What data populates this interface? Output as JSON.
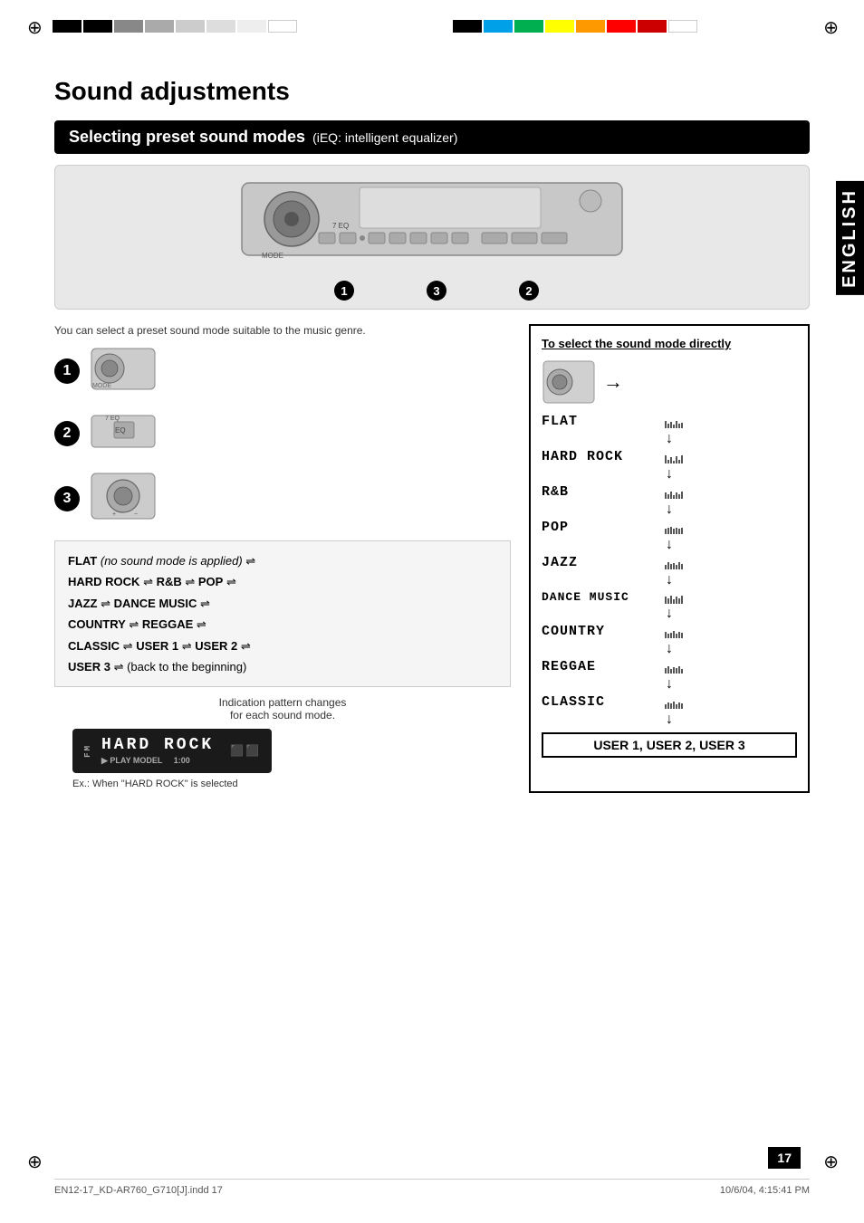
{
  "page": {
    "title": "Sound adjustments",
    "number": "17"
  },
  "section": {
    "header": "Selecting preset sound modes",
    "header_sub": "(iEQ: intelligent equalizer)"
  },
  "english_label": "ENGLISH",
  "device_numbers": [
    "1",
    "3",
    "2"
  ],
  "body_text": "You can select a preset sound mode suitable to the music genre.",
  "steps": [
    {
      "num": "1",
      "label": "MODE button"
    },
    {
      "num": "2",
      "label": "EQ button"
    },
    {
      "num": "3",
      "label": "Volume knob"
    }
  ],
  "mode_cycle": {
    "line1_bold": "FLAT",
    "line1_italic": " (no sound mode is applied)",
    "line1_sym": " ⇌",
    "line2": "HARD ROCK ⇌ R&B ⇌ POP ⇌",
    "line3": "JAZZ ⇌ DANCE MUSIC ⇌",
    "line4": "COUNTRY ⇌ REGGAE ⇌",
    "line5": "CLASSIC ⇌ USER 1 ⇌ USER 2 ⇌",
    "line6_bold": "USER 3",
    "line6": " ⇌ (back to the beginning)"
  },
  "indication_text": "Indication pattern changes\nfor each sound mode.",
  "example_label": "Ex.: When \"HARD ROCK\" is selected",
  "example_display": "HARD ROCK",
  "right_col": {
    "title": "To select the sound mode directly",
    "modes": [
      {
        "name": "FLAT",
        "bars": [
          8,
          5,
          7,
          4,
          8,
          3,
          6
        ]
      },
      {
        "name": "HARD ROCK",
        "bars": [
          9,
          4,
          7,
          3,
          8,
          4,
          9
        ]
      },
      {
        "name": "R&B",
        "bars": [
          7,
          5,
          8,
          4,
          7,
          5,
          8
        ]
      },
      {
        "name": "POP",
        "bars": [
          6,
          7,
          8,
          6,
          7,
          6,
          7
        ]
      },
      {
        "name": "JAZZ",
        "bars": [
          5,
          8,
          6,
          7,
          5,
          8,
          6
        ]
      },
      {
        "name": "DANCE MUSIC",
        "bars": [
          8,
          6,
          9,
          5,
          8,
          6,
          9
        ]
      },
      {
        "name": "COUNTRY",
        "bars": [
          7,
          5,
          6,
          8,
          5,
          7,
          6
        ]
      },
      {
        "name": "REGGAE",
        "bars": [
          6,
          8,
          5,
          7,
          6,
          8,
          5
        ]
      },
      {
        "name": "CLASSIC",
        "bars": [
          5,
          7,
          6,
          8,
          5,
          7,
          6
        ]
      }
    ],
    "last_item": "USER 1, USER 2, USER 3"
  },
  "footer": {
    "left": "EN12-17_KD-AR760_G710[J].indd  17",
    "right": "10/6/04, 4:15:41 PM"
  },
  "colors": {
    "black": "#000000",
    "white": "#ffffff",
    "gray": "#888888",
    "light_gray": "#e8e8e8"
  }
}
